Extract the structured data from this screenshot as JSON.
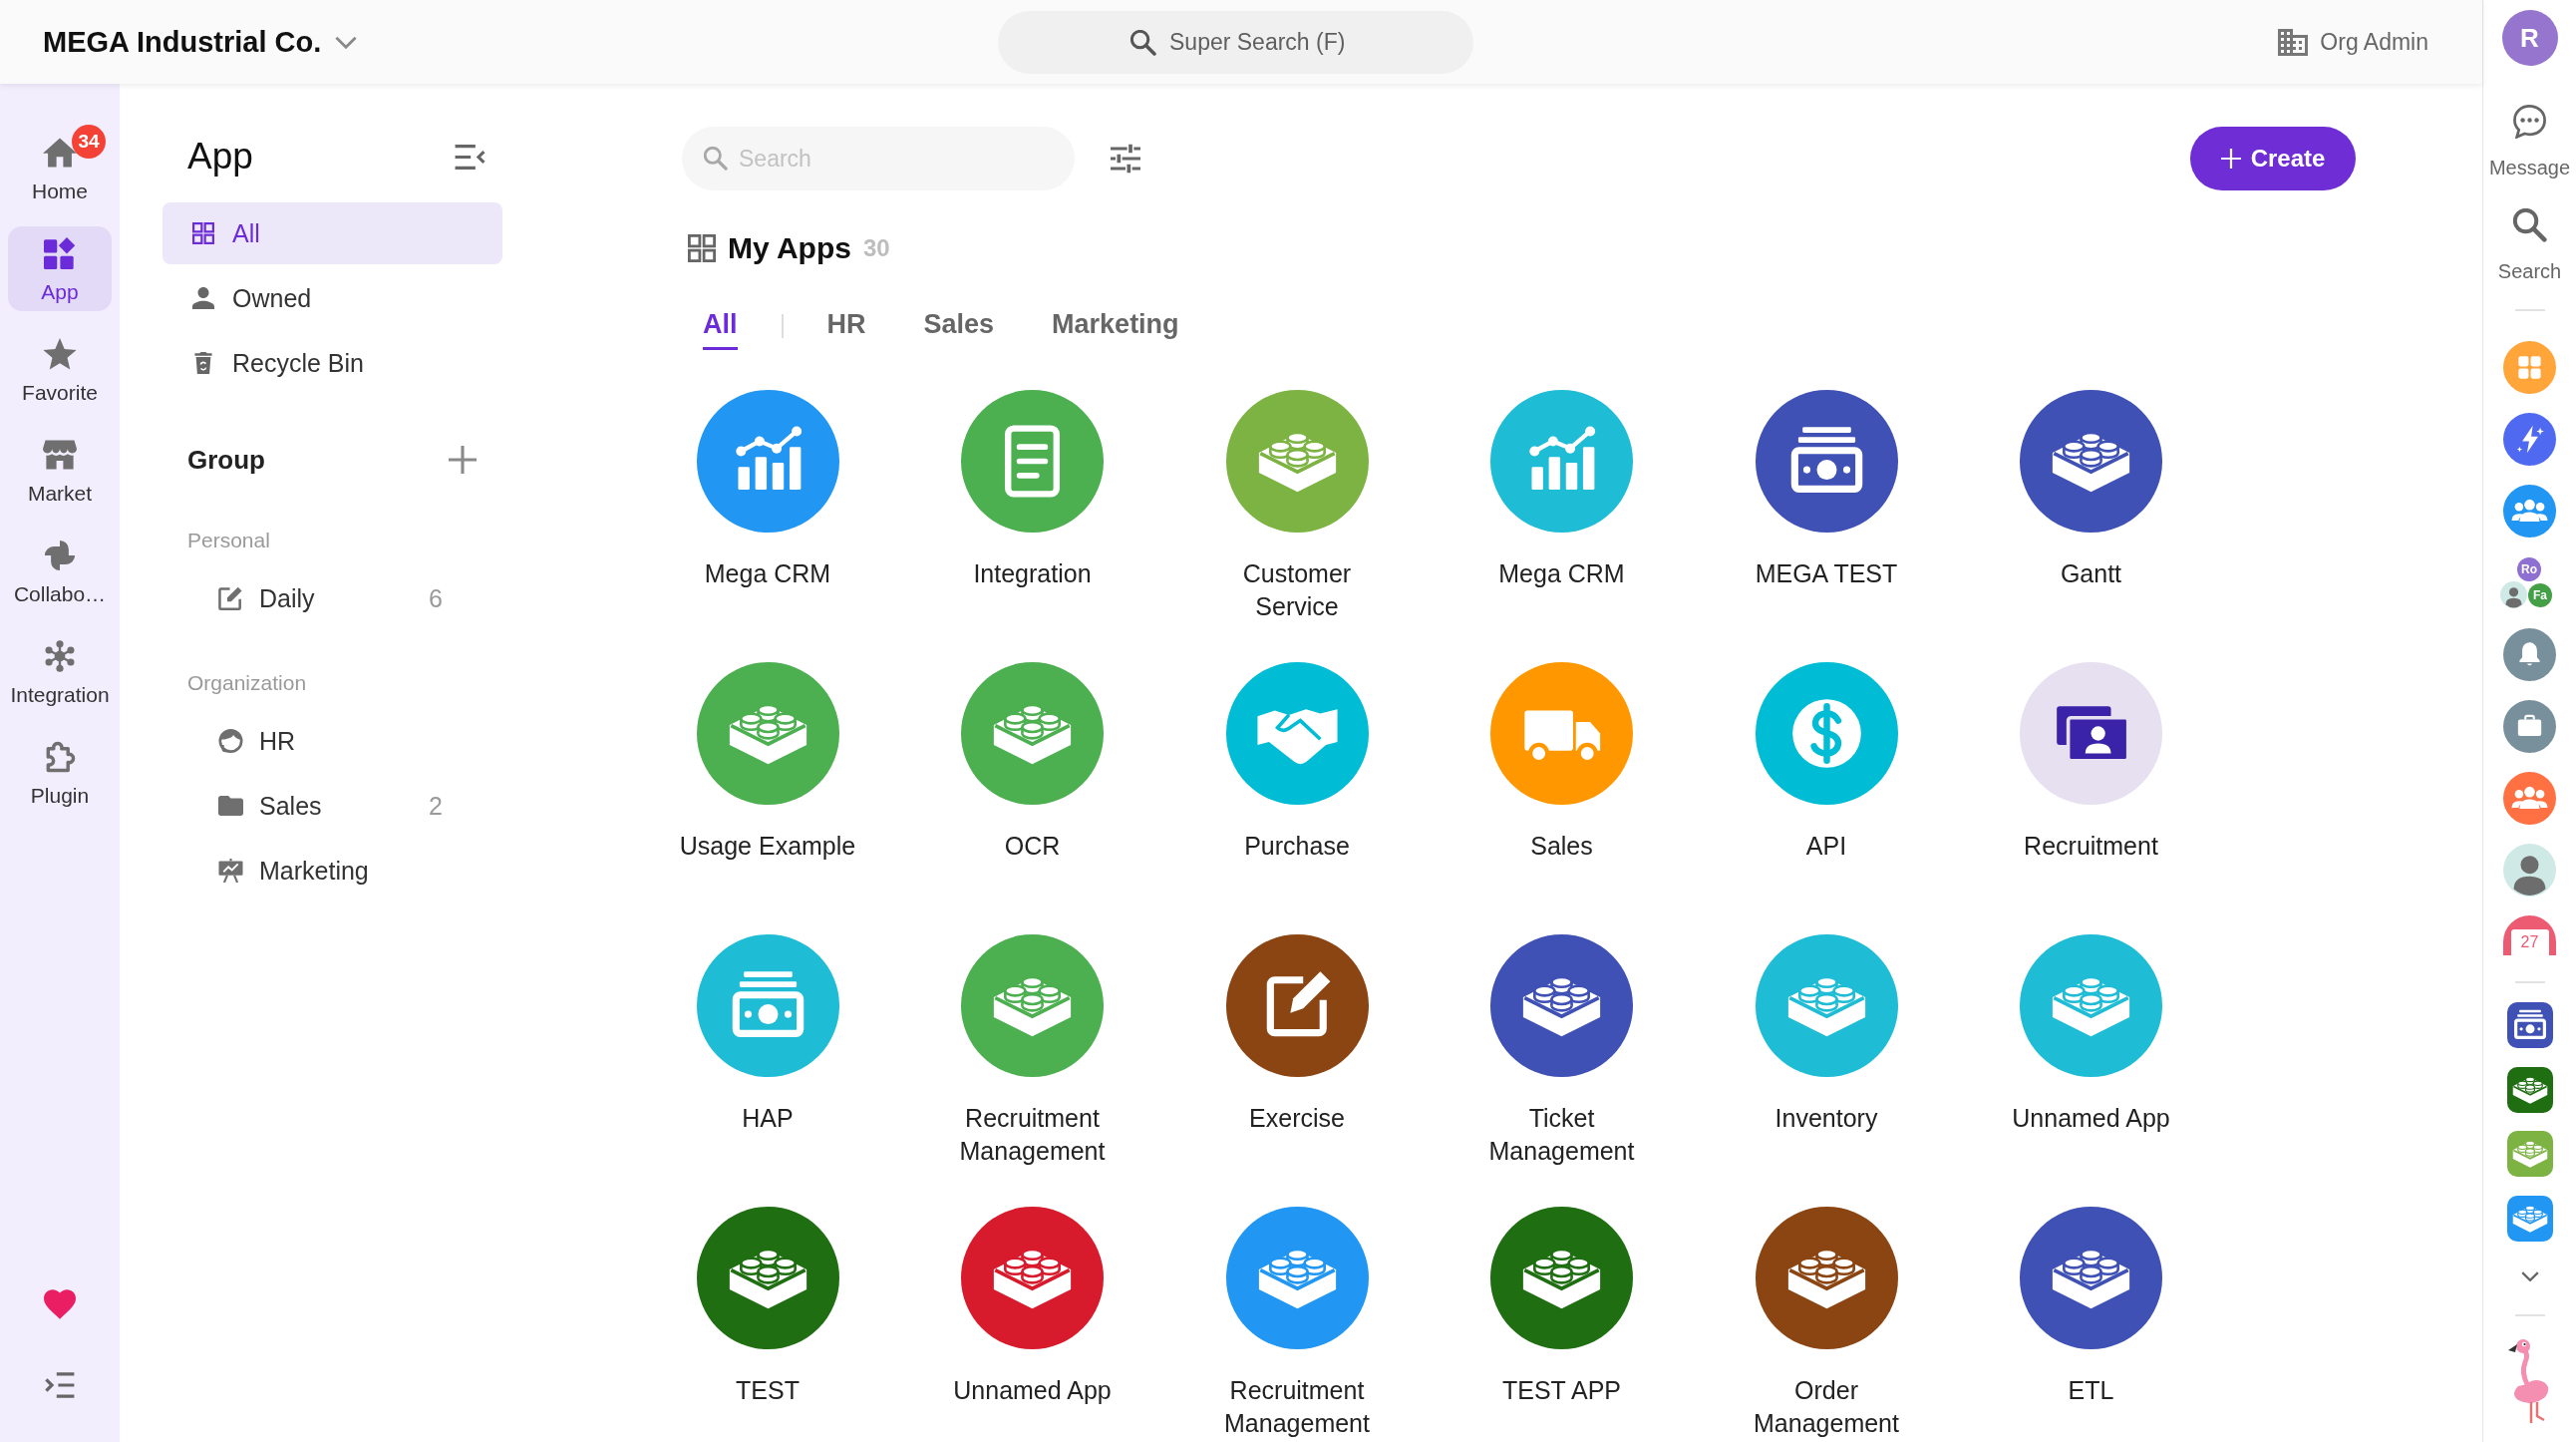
{
  "topbar": {
    "org_name": "MEGA Industrial Co.",
    "super_search": {
      "placeholder": "Super Search (F)"
    },
    "role": "Org Admin"
  },
  "nav": {
    "items": [
      {
        "label": "Home",
        "badge": "34",
        "selected": false
      },
      {
        "label": "App",
        "selected": true
      },
      {
        "label": "Favorite",
        "selected": false
      },
      {
        "label": "Market",
        "selected": false
      },
      {
        "label": "Collabo…",
        "selected": false
      },
      {
        "label": "Integration",
        "selected": false
      },
      {
        "label": "Plugin",
        "selected": false
      }
    ]
  },
  "sidebar": {
    "title": "App",
    "items": [
      {
        "label": "All",
        "selected": true
      },
      {
        "label": "Owned",
        "selected": false
      },
      {
        "label": "Recycle Bin",
        "selected": false
      }
    ],
    "group": {
      "title": "Group",
      "sections": [
        {
          "title": "Personal",
          "items": [
            {
              "label": "Daily",
              "count": "6",
              "selected": false
            }
          ]
        },
        {
          "title": "Organization",
          "items": [
            {
              "label": "HR",
              "selected": false
            },
            {
              "label": "Sales",
              "count": "2",
              "selected": false
            },
            {
              "label": "Marketing",
              "selected": false
            }
          ]
        }
      ]
    }
  },
  "main": {
    "search": {
      "placeholder": "Search"
    },
    "create_button": "Create",
    "section": {
      "title": "My Apps",
      "count": "30"
    },
    "tabs": [
      {
        "label": "All",
        "selected": true
      },
      {
        "label": "HR",
        "selected": false
      },
      {
        "label": "Sales",
        "selected": false
      },
      {
        "label": "Marketing",
        "selected": false
      }
    ],
    "apps": [
      {
        "name": "Mega CRM",
        "color": "#2196f3"
      },
      {
        "name": "Integration",
        "color": "#4caf50"
      },
      {
        "name": "Customer Service",
        "color": "#7cb342"
      },
      {
        "name": "Mega CRM",
        "color": "#1fbcd6"
      },
      {
        "name": "MEGA TEST",
        "color": "#3f51b5"
      },
      {
        "name": "Gantt",
        "color": "#3f51b5"
      },
      {
        "name": "Usage Example",
        "color": "#4caf50"
      },
      {
        "name": "OCR",
        "color": "#4caf50"
      },
      {
        "name": "Purchase",
        "color": "#00bcd4"
      },
      {
        "name": "Sales",
        "color": "#ff9800"
      },
      {
        "name": "API",
        "color": "#00bcd4"
      },
      {
        "name": "Recruitment",
        "color": "#e6e0f0"
      },
      {
        "name": "HAP",
        "color": "#1fbcd6"
      },
      {
        "name": "Recruitment Management",
        "color": "#4caf50"
      },
      {
        "name": "Exercise",
        "color": "#8b4513"
      },
      {
        "name": "Ticket Management",
        "color": "#3f51b5"
      },
      {
        "name": "Inventory",
        "color": "#1fbcd6"
      },
      {
        "name": "Unnamed App",
        "color": "#1fbcd6"
      },
      {
        "name": "TEST",
        "color": "#1f6f12"
      },
      {
        "name": "Unnamed App",
        "color": "#d81b2c"
      },
      {
        "name": "Recruitment Management",
        "color": "#2196f3"
      },
      {
        "name": "TEST APP",
        "color": "#1f6f12"
      },
      {
        "name": "Order Management",
        "color": "#8b4513"
      },
      {
        "name": "ETL",
        "color": "#3f51b5"
      }
    ]
  },
  "right_rail": {
    "avatar": "R",
    "items": [
      {
        "label": "Message"
      },
      {
        "label": "Search"
      }
    ],
    "shortcuts": [
      {
        "kind": "app",
        "color": "#ffa53a"
      },
      {
        "kind": "app",
        "color": "#4f6af0"
      },
      {
        "kind": "app",
        "color": "#2196f3"
      },
      {
        "kind": "members",
        "members": [
          {
            "initials": "Ro",
            "color": "#8e6fd2"
          },
          {
            "initials": "Fa",
            "color": "#43a047"
          }
        ]
      },
      {
        "kind": "app",
        "color": "#78909c"
      },
      {
        "kind": "app",
        "color": "#78909c"
      },
      {
        "kind": "app",
        "color": "#ff7043"
      },
      {
        "kind": "person"
      },
      {
        "kind": "calendar",
        "day": "27",
        "color": "#ec5b72"
      }
    ],
    "pinned": [
      {
        "color": "#3f51b5"
      },
      {
        "color": "#1f6f12"
      },
      {
        "color": "#7cb342"
      },
      {
        "color": "#2196f3"
      }
    ]
  }
}
